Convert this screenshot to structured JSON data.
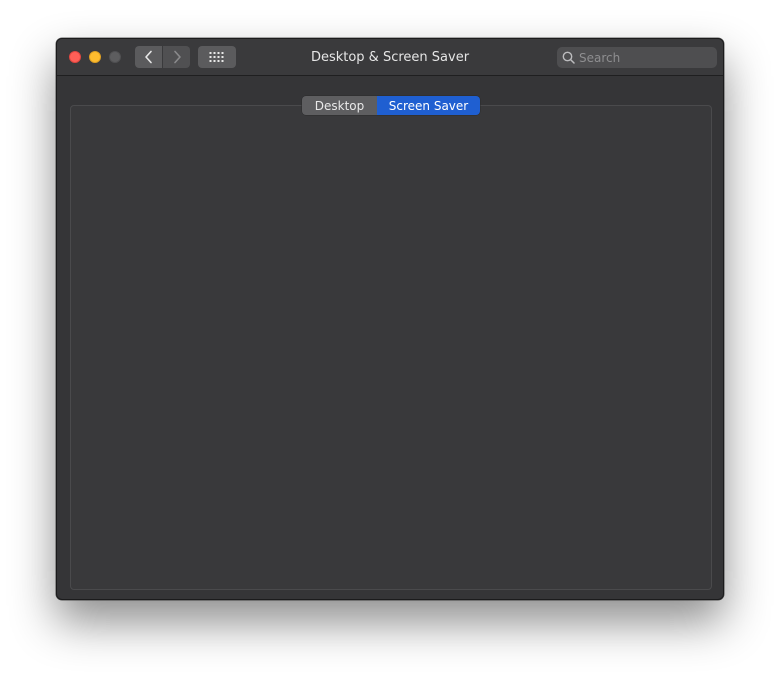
{
  "window": {
    "title": "Desktop & Screen Saver"
  },
  "toolbar": {
    "back_icon": "chevron-left-icon",
    "forward_icon": "chevron-right-icon",
    "grid_icon": "grid-icon",
    "search": {
      "placeholder": "Search",
      "value": "",
      "icon": "search-icon"
    }
  },
  "tabs": [
    {
      "label": "Desktop",
      "selected": false
    },
    {
      "label": "Screen Saver",
      "selected": true
    }
  ],
  "colors": {
    "accent": "#1f5fd1",
    "close": "#fe5f57",
    "minimize": "#febc2e",
    "zoom_disabled": "#5d5d5f"
  }
}
